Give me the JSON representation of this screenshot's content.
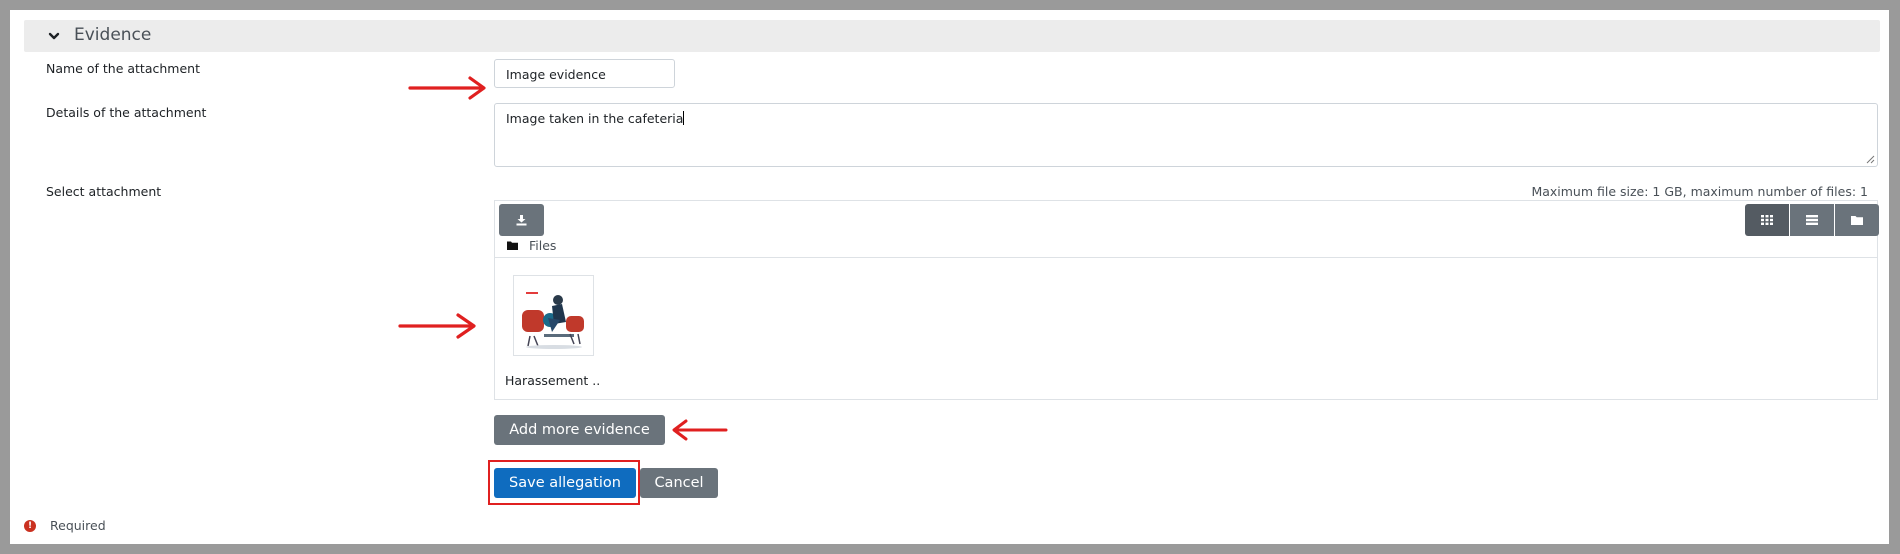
{
  "section": {
    "title": "Evidence",
    "expanded": true
  },
  "form": {
    "name_label": "Name of the attachment",
    "name_value": "Image evidence",
    "details_label": "Details of the attachment",
    "details_value": "Image taken in the cafeteria",
    "attachment_label": "Select attachment",
    "max_info": "Maximum file size: 1 GB, maximum number of files: 1"
  },
  "file_manager": {
    "path_label": "Files",
    "views": [
      "grid",
      "list",
      "tree"
    ],
    "active_view": "grid",
    "files": [
      {
        "name": "Harassement ..."
      }
    ]
  },
  "buttons": {
    "add_more": "Add more evidence",
    "save": "Save allegation",
    "cancel": "Cancel"
  },
  "footer": {
    "required_text": "Required"
  },
  "colors": {
    "primary": "#0f6cbf",
    "secondary": "#6a737b",
    "annotation": "#e02020",
    "required_icon": "#ca3120"
  },
  "icons": {
    "section_toggle": "chevron-down-icon",
    "upload": "download-icon",
    "folder": "folder-icon",
    "required": "exclamation-circle-icon"
  }
}
